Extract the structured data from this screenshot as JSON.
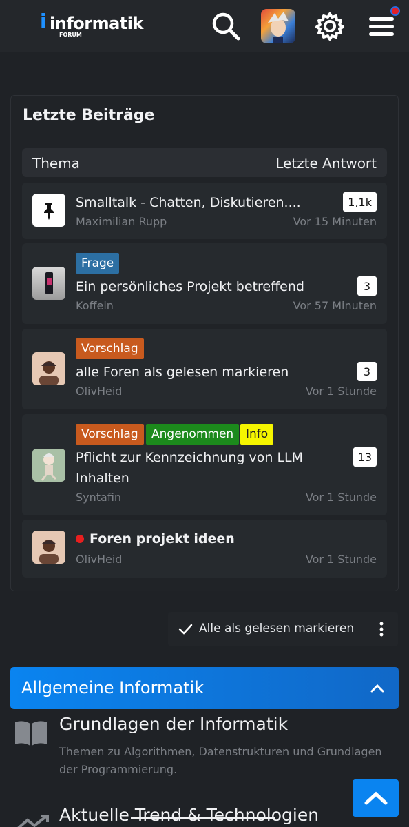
{
  "header": {
    "logo_text": "informatik",
    "logo_sub": "FORUM",
    "icons": [
      "search-icon",
      "avatar",
      "gear-icon",
      "hamburger-menu-icon"
    ],
    "notification_dot_color": "#e0202a"
  },
  "latest": {
    "title": "Letzte Beiträge",
    "col_topic": "Thema",
    "col_last": "Letzte Antwort",
    "rows": [
      {
        "title": "Smalltalk - Chatten, Diskutieren....",
        "author": "Maximilian Rupp",
        "time": "Vor 15 Minuten",
        "count": "1,1k",
        "pinned": true
      },
      {
        "tags": [
          "Frage"
        ],
        "title": "Ein persönliches Projekt betreffend",
        "author": "Koffein",
        "time": "Vor 57 Minuten",
        "count": "3"
      },
      {
        "tags": [
          "Vorschlag"
        ],
        "title": "alle Foren als gelesen markieren",
        "author": "OlivHeid",
        "time": "Vor 1 Stunde",
        "count": "3"
      },
      {
        "tags": [
          "Vorschlag",
          "Angenommen",
          "Info"
        ],
        "title_line1": "Pflicht zur Kennzeichnung von LLM",
        "title_line2": "Inhalten",
        "author": "Syntafin",
        "time": "Vor 1 Stunde",
        "count": "13"
      },
      {
        "title": "Foren projekt ideen",
        "author": "OlivHeid",
        "time": "Vor 1 Stunde",
        "unread": true
      }
    ]
  },
  "actions": {
    "mark_all_read": "Alle als gelesen markieren"
  },
  "category": {
    "title": "Allgemeine Informatik",
    "forums": [
      {
        "title": "Grundlagen der Informatik",
        "desc": "Themen zu Algorithmen, Datenstrukturen und Grundlagen der Programmierung."
      },
      {
        "title": "Aktuelle Trend & Technologien"
      }
    ]
  },
  "colors": {
    "accent": "#0a84f0",
    "frage": "#2c6fa3",
    "vorschlag": "#c85a1e",
    "angenommen": "#1c8a1c",
    "info": "#f5f500"
  }
}
